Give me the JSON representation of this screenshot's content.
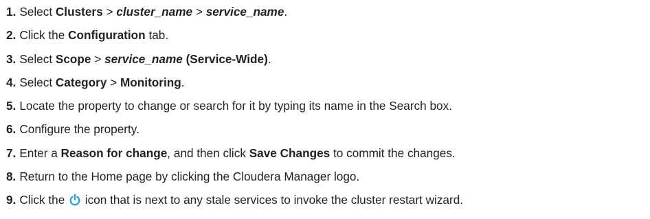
{
  "steps": [
    {
      "num": "1.",
      "parts": [
        {
          "t": "Select "
        },
        {
          "t": "Clusters",
          "s": "b"
        },
        {
          "t": " > "
        },
        {
          "t": "cluster_name",
          "s": "bi"
        },
        {
          "t": " > "
        },
        {
          "t": "service_name",
          "s": "bi"
        },
        {
          "t": "."
        }
      ]
    },
    {
      "num": "2.",
      "parts": [
        {
          "t": "Click the "
        },
        {
          "t": "Configuration",
          "s": "b"
        },
        {
          "t": " tab."
        }
      ]
    },
    {
      "num": "3.",
      "parts": [
        {
          "t": "Select "
        },
        {
          "t": "Scope",
          "s": "b"
        },
        {
          "t": " > "
        },
        {
          "t": "service_name",
          "s": "bi"
        },
        {
          "t": " (Service-Wide)",
          "s": "b"
        },
        {
          "t": "."
        }
      ]
    },
    {
      "num": "4.",
      "parts": [
        {
          "t": "Select "
        },
        {
          "t": "Category",
          "s": "b"
        },
        {
          "t": " > "
        },
        {
          "t": "Monitoring",
          "s": "b"
        },
        {
          "t": "."
        }
      ]
    },
    {
      "num": "5.",
      "parts": [
        {
          "t": "Locate the property to change or search for it by typing its name in the Search box."
        }
      ]
    },
    {
      "num": "6.",
      "parts": [
        {
          "t": "Configure the property."
        }
      ]
    },
    {
      "num": "7.",
      "parts": [
        {
          "t": "Enter a "
        },
        {
          "t": "Reason for change",
          "s": "b"
        },
        {
          "t": ", and then click "
        },
        {
          "t": "Save Changes",
          "s": "b"
        },
        {
          "t": " to commit the changes."
        }
      ]
    },
    {
      "num": "8.",
      "parts": [
        {
          "t": "Return to the Home page by clicking the Cloudera Manager logo."
        }
      ]
    },
    {
      "num": "9.",
      "parts": [
        {
          "t": "Click the "
        },
        {
          "icon": "restart-icon"
        },
        {
          "t": " icon that is next to any stale services to invoke the cluster restart wizard."
        }
      ]
    }
  ],
  "colors": {
    "text": "#222222",
    "icon": "#2f9ad6"
  }
}
